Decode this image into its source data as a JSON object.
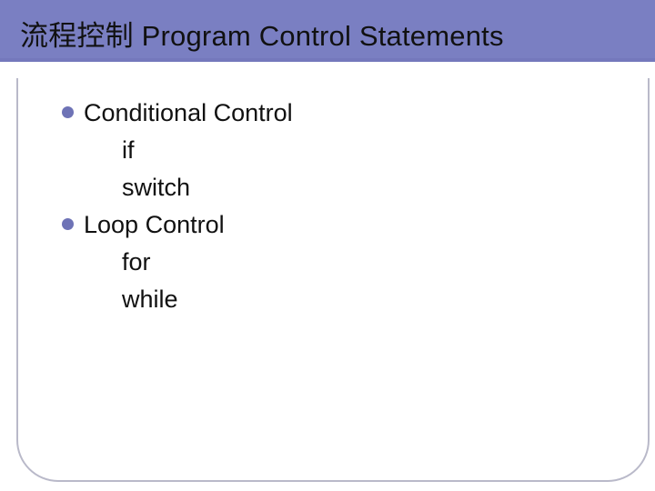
{
  "header": {
    "title_cn": "流程控制",
    "title_en": "Program Control Statements"
  },
  "content": {
    "bullets": [
      {
        "label": "Conditional Control",
        "items": [
          "if",
          "switch"
        ]
      },
      {
        "label": "Loop Control",
        "items": [
          "for",
          "while"
        ]
      }
    ]
  }
}
